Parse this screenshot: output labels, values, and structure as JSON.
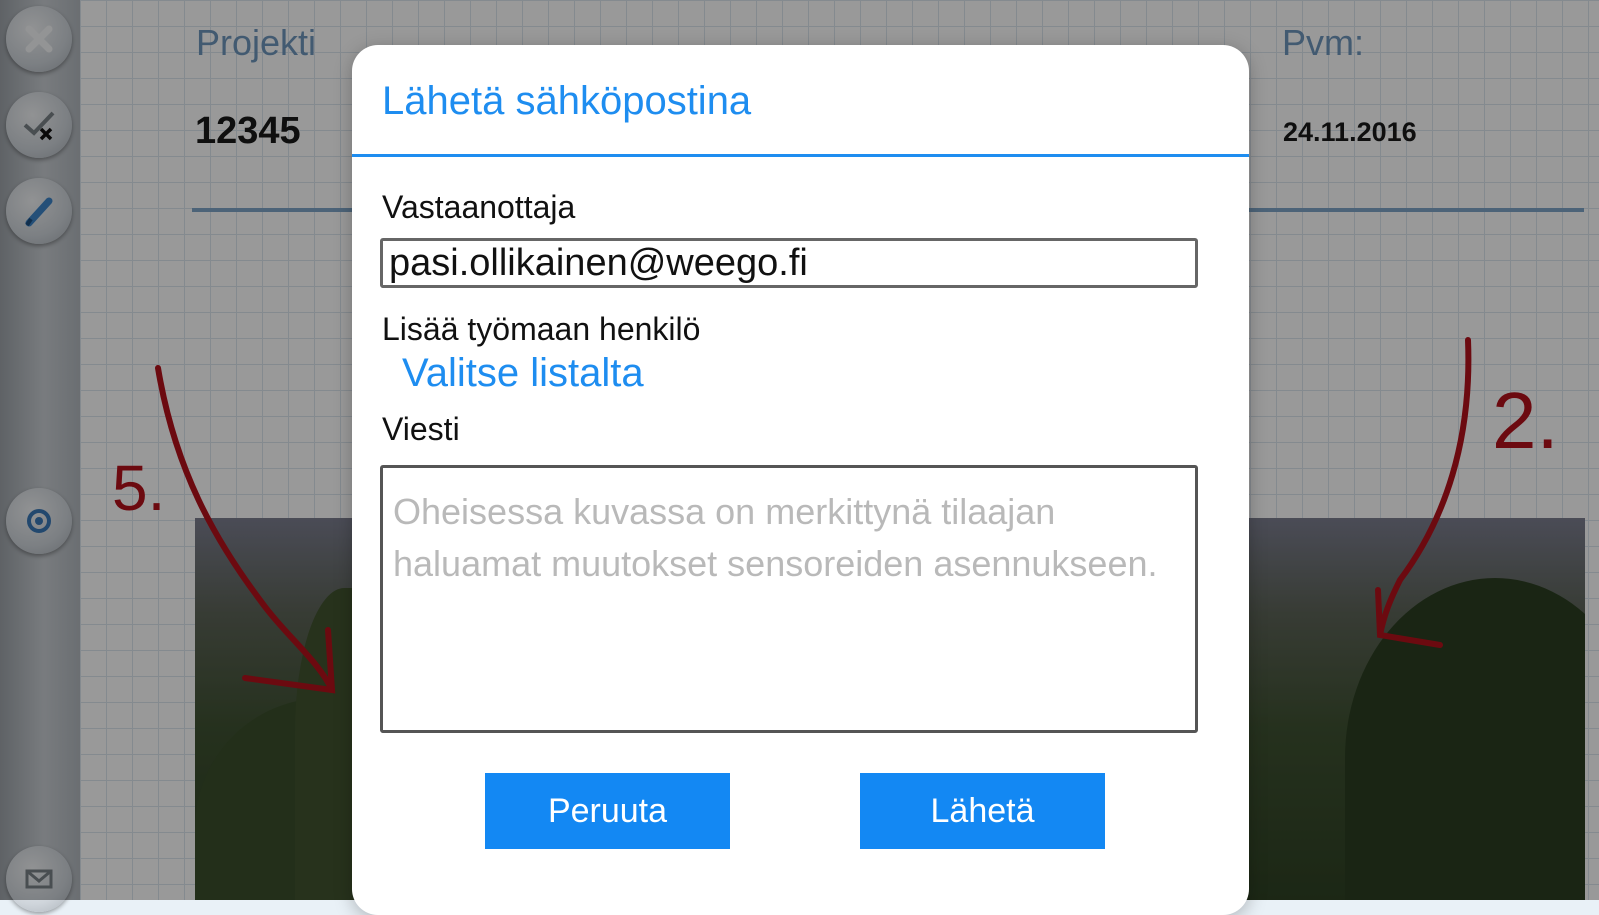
{
  "document": {
    "project_label": "Projekti",
    "project_value": "12345",
    "date_label": "Pvm:",
    "date_value": "24.11.2016"
  },
  "annotations": [
    "5.",
    "2."
  ],
  "sidebar": {
    "tools": [
      "close-icon",
      "check-remove-icon",
      "pen-icon",
      "camera-icon",
      "mail-icon"
    ]
  },
  "dialog": {
    "title": "Lähetä sähköpostina",
    "recipient_label": "Vastaanottaja",
    "recipient_value": "pasi.ollikainen@weego.fi",
    "add_person_label": "Lisää työmaan henkilö",
    "pick_from_list": "Valitse listalta",
    "message_label": "Viesti",
    "message_placeholder": "Oheisessa kuvassa on merkittynä tilaajan haluamat muutokset sensoreiden asennukseen.",
    "cancel_button": "Peruuta",
    "send_button": "Lähetä"
  },
  "colors": {
    "accent": "#1e8df0",
    "button": "#1388f3",
    "annotation": "#b5121b"
  }
}
